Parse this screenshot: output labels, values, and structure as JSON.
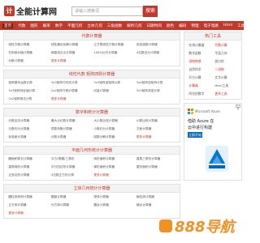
{
  "header": {
    "logo_mark": "计算",
    "site_name": "全能计算网",
    "search_placeholder": "请输入搜索词",
    "search_button": "搜索"
  },
  "nav": [
    "首页",
    "代数",
    "图形",
    "概率",
    "数学",
    "平面几何",
    "立体几何",
    "三角函数",
    "解析几何",
    "日期时间",
    "颜色",
    "编码",
    "物理",
    "电子电路",
    "Html",
    "工具",
    "生活",
    "截图 ▽"
  ],
  "sections": [
    {
      "title": "代数计算器",
      "items": [
        "线性方程计算器",
        "线性最优化解计算器",
        "立方根线性方程计算器",
        "余弦函数计算器",
        "右斜绝对值计算器",
        "两直线交点计算器",
        "100%比尔计算器",
        "4位数百分计算器",
        "对数计算器",
        "更多计算器"
      ]
    },
    {
      "title": "线性代数 矩阵四则计算器",
      "items": [
        "矩阵基本运算计算",
        "3x3矩阵行列式计算",
        "3x3矩阵逆矩阵计算",
        "3x4矩阵逆矩阵计算",
        "3x3矩阵特征值计算",
        "2x2矩阵方程计算器",
        "向量计算器",
        "3x3矩阵求逆计算",
        "2x2矩阵乘法计算",
        "更多计算器"
      ]
    },
    {
      "title": "数字和统计计算器",
      "items": [
        "分数加法计算器",
        "最大公约数计算器",
        "大小数比较计算器",
        "小数比较计算器",
        "分数约分计算器",
        "质数判断计算器",
        "小数约分计算器",
        "方差计算器",
        "标准差计算器",
        "分数计算器",
        "因数分解计算器",
        "更多计算器"
      ]
    },
    {
      "title": "平面几何形统计计算器",
      "items": [
        "圆面积周长计算器",
        "平方(等腰)三角形",
        "扇形面积计算器",
        "直角三角形计算器",
        "直角梯形计算器",
        "平行四边形计算器",
        "梯形面积计算器",
        "菱形面积计算器",
        "正多边形计算器",
        "4位数正方形计算",
        "更多计算器"
      ]
    },
    {
      "title": "立体几何统计计算器",
      "items": [
        "圆柱体体积计算器",
        "圆锥计算器",
        "球体计算器",
        "棱柱体计算器",
        "正方体计算器",
        "长方体计算器",
        "圆台计算器",
        "棱台计算器",
        "更多计算器"
      ]
    }
  ],
  "sidebar": {
    "title": "热门工具",
    "items": [
      "在线计算器",
      "代数计算",
      "数学函数",
      "平面几何",
      "进制转换",
      "度分秒",
      "自然科学",
      "二进制",
      "开方计算",
      "文字计算",
      "计算器",
      "Html工具",
      "阿拉伯数字",
      "更多工具"
    ]
  },
  "ad": {
    "brand": "Microsoft Azure",
    "line1": "借助 Azure 在",
    "line2": "云中进行构建",
    "button": "立即开始",
    "mark": "广告"
  },
  "watermark": {
    "text": "888导航"
  },
  "colors": {
    "brand_red": "#c0392b",
    "azure_blue": "#0067b8",
    "watermark_orange": "#f08c1a"
  }
}
